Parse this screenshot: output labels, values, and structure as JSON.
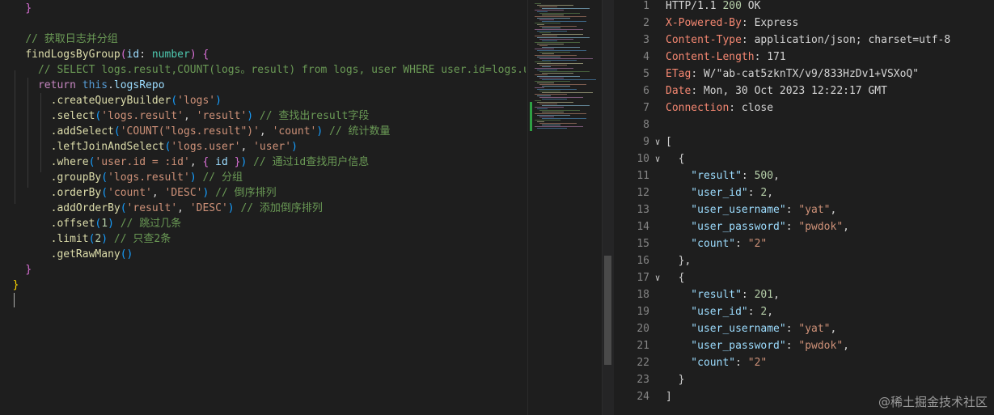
{
  "editor": {
    "lines": [
      {
        "indent": "  ",
        "parts": [
          {
            "t": "}",
            "c": "br1"
          }
        ]
      },
      {
        "indent": "",
        "parts": []
      },
      {
        "indent": "  ",
        "parts": [
          {
            "t": "// 获取日志并分组",
            "c": "cm"
          }
        ]
      },
      {
        "indent": "  ",
        "parts": [
          {
            "t": "findLogsByGroup",
            "c": "fn"
          },
          {
            "t": "(",
            "c": "br1"
          },
          {
            "t": "id",
            "c": "prop"
          },
          {
            "t": ": ",
            "c": "v"
          },
          {
            "t": "number",
            "c": "type"
          },
          {
            "t": ") ",
            "c": "br1"
          },
          {
            "t": "{",
            "c": "br1"
          }
        ]
      },
      {
        "indent": "    ",
        "parts": [
          {
            "t": "// SELECT logs.result,COUNT(logs。result) from logs, user WHERE user.id=logs.use",
            "c": "cm"
          }
        ]
      },
      {
        "indent": "    ",
        "parts": [
          {
            "t": "return ",
            "c": "kw"
          },
          {
            "t": "this",
            "c": "kw2"
          },
          {
            "t": ".",
            "c": "v"
          },
          {
            "t": "logsRepo",
            "c": "prop"
          }
        ]
      },
      {
        "indent": "      ",
        "parts": [
          {
            "t": ".createQueryBuilder",
            "c": "fn"
          },
          {
            "t": "(",
            "c": "br3"
          },
          {
            "t": "'logs'",
            "c": "str"
          },
          {
            "t": ")",
            "c": "br3"
          }
        ]
      },
      {
        "indent": "      ",
        "parts": [
          {
            "t": ".select",
            "c": "fn"
          },
          {
            "t": "(",
            "c": "br3"
          },
          {
            "t": "'logs.result'",
            "c": "str"
          },
          {
            "t": ", ",
            "c": "v"
          },
          {
            "t": "'result'",
            "c": "str"
          },
          {
            "t": ")",
            "c": "br3"
          },
          {
            "t": " // 查找出result字段",
            "c": "cm"
          }
        ]
      },
      {
        "indent": "      ",
        "parts": [
          {
            "t": ".addSelect",
            "c": "fn"
          },
          {
            "t": "(",
            "c": "br3"
          },
          {
            "t": "'COUNT(\"logs.result\")'",
            "c": "str"
          },
          {
            "t": ", ",
            "c": "v"
          },
          {
            "t": "'count'",
            "c": "str"
          },
          {
            "t": ")",
            "c": "br3"
          },
          {
            "t": " // 统计数量",
            "c": "cm"
          }
        ]
      },
      {
        "indent": "      ",
        "parts": [
          {
            "t": ".leftJoinAndSelect",
            "c": "fn"
          },
          {
            "t": "(",
            "c": "br3"
          },
          {
            "t": "'logs.user'",
            "c": "str"
          },
          {
            "t": ", ",
            "c": "v"
          },
          {
            "t": "'user'",
            "c": "str"
          },
          {
            "t": ")",
            "c": "br3"
          }
        ]
      },
      {
        "indent": "      ",
        "parts": [
          {
            "t": ".where",
            "c": "fn"
          },
          {
            "t": "(",
            "c": "br3"
          },
          {
            "t": "'user.id = :id'",
            "c": "str"
          },
          {
            "t": ", ",
            "c": "v"
          },
          {
            "t": "{",
            "c": "br1"
          },
          {
            "t": " id ",
            "c": "prop"
          },
          {
            "t": "}",
            "c": "br1"
          },
          {
            "t": ")",
            "c": "br3"
          },
          {
            "t": " // 通过id查找用户信息",
            "c": "cm"
          }
        ]
      },
      {
        "indent": "      ",
        "parts": [
          {
            "t": ".groupBy",
            "c": "fn"
          },
          {
            "t": "(",
            "c": "br3"
          },
          {
            "t": "'logs.result'",
            "c": "str"
          },
          {
            "t": ")",
            "c": "br3"
          },
          {
            "t": " // 分组",
            "c": "cm"
          }
        ]
      },
      {
        "indent": "      ",
        "parts": [
          {
            "t": ".orderBy",
            "c": "fn"
          },
          {
            "t": "(",
            "c": "br3"
          },
          {
            "t": "'count'",
            "c": "str"
          },
          {
            "t": ", ",
            "c": "v"
          },
          {
            "t": "'DESC'",
            "c": "str"
          },
          {
            "t": ")",
            "c": "br3"
          },
          {
            "t": " // 倒序排列",
            "c": "cm"
          }
        ]
      },
      {
        "indent": "      ",
        "parts": [
          {
            "t": ".addOrderBy",
            "c": "fn"
          },
          {
            "t": "(",
            "c": "br3"
          },
          {
            "t": "'result'",
            "c": "str"
          },
          {
            "t": ", ",
            "c": "v"
          },
          {
            "t": "'DESC'",
            "c": "str"
          },
          {
            "t": ")",
            "c": "br3"
          },
          {
            "t": " // 添加倒序排列",
            "c": "cm"
          }
        ]
      },
      {
        "indent": "      ",
        "parts": [
          {
            "t": ".offset",
            "c": "fn"
          },
          {
            "t": "(",
            "c": "br3"
          },
          {
            "t": "1",
            "c": "num"
          },
          {
            "t": ")",
            "c": "br3"
          },
          {
            "t": " // 跳过几条",
            "c": "cm"
          }
        ]
      },
      {
        "indent": "      ",
        "parts": [
          {
            "t": ".limit",
            "c": "fn"
          },
          {
            "t": "(",
            "c": "br3"
          },
          {
            "t": "2",
            "c": "num"
          },
          {
            "t": ")",
            "c": "br3"
          },
          {
            "t": " // 只查2条",
            "c": "cm"
          }
        ]
      },
      {
        "indent": "      ",
        "parts": [
          {
            "t": ".getRawMany",
            "c": "fn"
          },
          {
            "t": "()",
            "c": "br3"
          }
        ]
      },
      {
        "indent": "  ",
        "parts": [
          {
            "t": "}",
            "c": "br1"
          }
        ]
      },
      {
        "indent": "",
        "parts": [
          {
            "t": "}",
            "c": "br2"
          }
        ]
      },
      {
        "indent": "",
        "parts": []
      }
    ]
  },
  "response": {
    "lines": [
      {
        "n": "1",
        "fold": "",
        "parts": [
          {
            "t": "HTTP/1.1 ",
            "c": "v"
          },
          {
            "t": "200",
            "c": "num"
          },
          {
            "t": " OK",
            "c": "v"
          }
        ]
      },
      {
        "n": "2",
        "fold": "",
        "parts": [
          {
            "t": "X-Powered-By",
            "c": "k"
          },
          {
            "t": ": Express",
            "c": "v"
          }
        ]
      },
      {
        "n": "3",
        "fold": "",
        "parts": [
          {
            "t": "Content-Type",
            "c": "k"
          },
          {
            "t": ": application/json; charset=utf-8",
            "c": "v"
          }
        ]
      },
      {
        "n": "4",
        "fold": "",
        "parts": [
          {
            "t": "Content-Length",
            "c": "k"
          },
          {
            "t": ": 171",
            "c": "v"
          }
        ]
      },
      {
        "n": "5",
        "fold": "",
        "parts": [
          {
            "t": "ETag",
            "c": "k"
          },
          {
            "t": ": W/\"ab-cat5zknTX/v9/833HzDv1+VSXoQ\"",
            "c": "v"
          }
        ]
      },
      {
        "n": "6",
        "fold": "",
        "parts": [
          {
            "t": "Date",
            "c": "k"
          },
          {
            "t": ": Mon, 30 Oct 2023 12:22:17 GMT",
            "c": "v"
          }
        ]
      },
      {
        "n": "7",
        "fold": "",
        "parts": [
          {
            "t": "Connection",
            "c": "k"
          },
          {
            "t": ": close",
            "c": "v"
          }
        ]
      },
      {
        "n": "8",
        "fold": "",
        "parts": []
      },
      {
        "n": "9",
        "fold": "∨",
        "parts": [
          {
            "t": "[",
            "c": "v"
          }
        ]
      },
      {
        "n": "10",
        "fold": "∨",
        "parts": [
          {
            "t": "  {",
            "c": "v"
          }
        ]
      },
      {
        "n": "11",
        "fold": "",
        "parts": [
          {
            "t": "    \"result\"",
            "c": "jkey"
          },
          {
            "t": ": ",
            "c": "v"
          },
          {
            "t": "500",
            "c": "num"
          },
          {
            "t": ",",
            "c": "v"
          }
        ]
      },
      {
        "n": "12",
        "fold": "",
        "parts": [
          {
            "t": "    \"user_id\"",
            "c": "jkey"
          },
          {
            "t": ": ",
            "c": "v"
          },
          {
            "t": "2",
            "c": "num"
          },
          {
            "t": ",",
            "c": "v"
          }
        ]
      },
      {
        "n": "13",
        "fold": "",
        "parts": [
          {
            "t": "    \"user_username\"",
            "c": "jkey"
          },
          {
            "t": ": ",
            "c": "v"
          },
          {
            "t": "\"yat\"",
            "c": "str"
          },
          {
            "t": ",",
            "c": "v"
          }
        ]
      },
      {
        "n": "14",
        "fold": "",
        "parts": [
          {
            "t": "    \"user_password\"",
            "c": "jkey"
          },
          {
            "t": ": ",
            "c": "v"
          },
          {
            "t": "\"pwdok\"",
            "c": "str"
          },
          {
            "t": ",",
            "c": "v"
          }
        ]
      },
      {
        "n": "15",
        "fold": "",
        "parts": [
          {
            "t": "    \"count\"",
            "c": "jkey"
          },
          {
            "t": ": ",
            "c": "v"
          },
          {
            "t": "\"2\"",
            "c": "str"
          }
        ]
      },
      {
        "n": "16",
        "fold": "",
        "parts": [
          {
            "t": "  },",
            "c": "v"
          }
        ]
      },
      {
        "n": "17",
        "fold": "∨",
        "parts": [
          {
            "t": "  {",
            "c": "v"
          }
        ]
      },
      {
        "n": "18",
        "fold": "",
        "parts": [
          {
            "t": "    \"result\"",
            "c": "jkey"
          },
          {
            "t": ": ",
            "c": "v"
          },
          {
            "t": "201",
            "c": "num"
          },
          {
            "t": ",",
            "c": "v"
          }
        ]
      },
      {
        "n": "19",
        "fold": "",
        "parts": [
          {
            "t": "    \"user_id\"",
            "c": "jkey"
          },
          {
            "t": ": ",
            "c": "v"
          },
          {
            "t": "2",
            "c": "num"
          },
          {
            "t": ",",
            "c": "v"
          }
        ]
      },
      {
        "n": "20",
        "fold": "",
        "parts": [
          {
            "t": "    \"user_username\"",
            "c": "jkey"
          },
          {
            "t": ": ",
            "c": "v"
          },
          {
            "t": "\"yat\"",
            "c": "str"
          },
          {
            "t": ",",
            "c": "v"
          }
        ]
      },
      {
        "n": "21",
        "fold": "",
        "parts": [
          {
            "t": "    \"user_password\"",
            "c": "jkey"
          },
          {
            "t": ": ",
            "c": "v"
          },
          {
            "t": "\"pwdok\"",
            "c": "str"
          },
          {
            "t": ",",
            "c": "v"
          }
        ]
      },
      {
        "n": "22",
        "fold": "",
        "parts": [
          {
            "t": "    \"count\"",
            "c": "jkey"
          },
          {
            "t": ": ",
            "c": "v"
          },
          {
            "t": "\"2\"",
            "c": "str"
          }
        ]
      },
      {
        "n": "23",
        "fold": "",
        "parts": [
          {
            "t": "  }",
            "c": "v"
          }
        ]
      },
      {
        "n": "24",
        "fold": "",
        "parts": [
          {
            "t": "]",
            "c": "v"
          }
        ]
      }
    ]
  },
  "watermark": "@稀土掘金技术社区"
}
